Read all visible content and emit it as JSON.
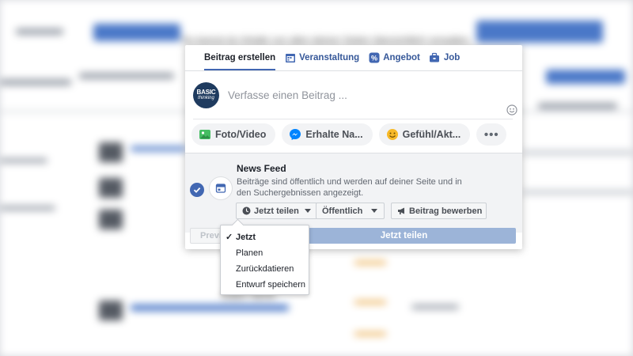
{
  "background": {
    "hint_text": "Du kannst du Inhalte von allen deinen Seiten übersichtlich verwalten.",
    "snippet_text": "endlich. WEHR"
  },
  "tabs": [
    {
      "label": "Beitrag erstellen",
      "icon": "edit-icon"
    },
    {
      "label": "Veranstaltung",
      "icon": "calendar-icon"
    },
    {
      "label": "Angebot",
      "icon": "offer-icon"
    },
    {
      "label": "Job",
      "icon": "briefcase-icon"
    }
  ],
  "composer": {
    "avatar_line1": "BASIC",
    "avatar_line2": "thinking",
    "placeholder": "Verfasse einen Beitrag ..."
  },
  "actions": [
    {
      "label": "Foto/Video",
      "icon": "photo-icon"
    },
    {
      "label": "Erhalte Na...",
      "icon": "messenger-icon"
    },
    {
      "label": "Gefühl/Akt...",
      "icon": "smiley-icon"
    },
    {
      "label": "•••",
      "icon": "more-icon"
    }
  ],
  "audience": {
    "title": "News Feed",
    "description": "Beiträge sind öffentlich und werden auf deiner Seite und in den Suchergebnissen angezeigt.",
    "share_now_label": "Jetzt teilen",
    "privacy_label": "Öffentlich",
    "promote_label": "Beitrag bewerben"
  },
  "footer": {
    "preview_label": "Previ",
    "share_label": "Jetzt teilen"
  },
  "menu": {
    "items": [
      "Jetzt",
      "Planen",
      "Zurückdatieren",
      "Entwurf speichern"
    ],
    "selected": "Jetzt"
  },
  "colors": {
    "accent": "#4267b2",
    "share_button": "#9cb4d8",
    "audience_bg": "#f2f3f5"
  }
}
